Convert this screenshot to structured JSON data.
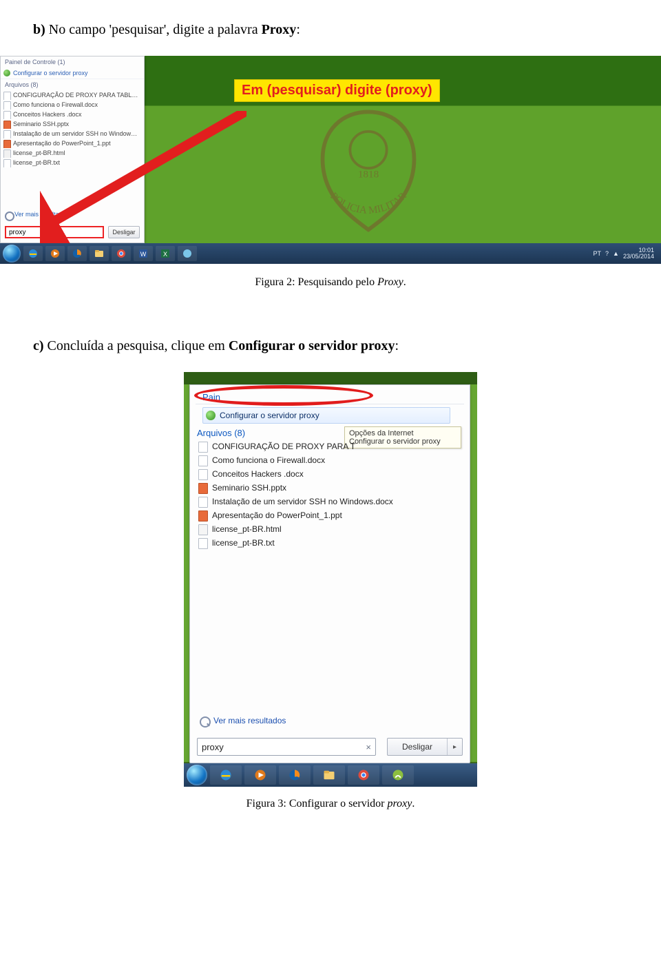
{
  "step_b": {
    "lead": "b)",
    "text": " No campo 'pesquisar', digite a palavra ",
    "tail": "Proxy",
    "colon": ":"
  },
  "fig1": {
    "panel": {
      "cp_header": "Painel de Controle (1)",
      "cp_item": "Configurar o servidor proxy",
      "files_header": "Arquivos (8)",
      "files": [
        "CONFIGURAÇÃO DE PROXY PARA TABLET.txt",
        "Como funciona o Firewall.docx",
        "Conceitos Hackers .docx",
        "Seminario SSH.pptx",
        "Instalação de um servidor SSH no Windows.docx",
        "Apresentação do PowerPoint_1.ppt",
        "license_pt-BR.html",
        "license_pt-BR.txt"
      ],
      "more": "Ver mais resultados",
      "search_value": "proxy",
      "shutdown": "Desligar"
    },
    "callout": "Em (pesquisar) digite (proxy)",
    "badge": {
      "year": "1818",
      "motto": "POLICIA MILITAR"
    },
    "tray": {
      "lang": "PT",
      "time": "10:01",
      "date": "23/05/2014"
    }
  },
  "caption1": {
    "pre": "Figura 2: Pesquisando pelo ",
    "it": "Proxy",
    "post": "."
  },
  "step_c": {
    "lead": "c)",
    "text": " Concluída a pesquisa, clique em ",
    "tail": "Configurar o servidor proxy",
    "colon": ":"
  },
  "fig2": {
    "panel": {
      "pain_trunc": "Pain",
      "cp_item": "Configurar o servidor proxy",
      "files_header": "Arquivos (8)",
      "tooltip_line1": "Opções da Internet",
      "tooltip_line2": "Configurar o servidor proxy",
      "files": [
        {
          "name": "CONFIGURAÇÃO DE PROXY PARA T",
          "cls": "txt"
        },
        {
          "name": "Como funciona o Firewall.docx",
          "cls": "docx"
        },
        {
          "name": "Conceitos Hackers .docx",
          "cls": "docx"
        },
        {
          "name": "Seminario SSH.pptx",
          "cls": "pptx"
        },
        {
          "name": "Instalação de um servidor SSH no Windows.docx",
          "cls": "docx"
        },
        {
          "name": "Apresentação do PowerPoint_1.ppt",
          "cls": "ppt"
        },
        {
          "name": "license_pt-BR.html",
          "cls": "html"
        },
        {
          "name": "license_pt-BR.txt",
          "cls": "txt"
        }
      ],
      "more": "Ver mais resultados",
      "search_value": "proxy",
      "clear": "×",
      "shutdown": "Desligar",
      "shutdown_arrow": "▸"
    }
  },
  "caption2": {
    "pre": "Figura 3: Configurar o servidor ",
    "it": "proxy",
    "post": "."
  }
}
